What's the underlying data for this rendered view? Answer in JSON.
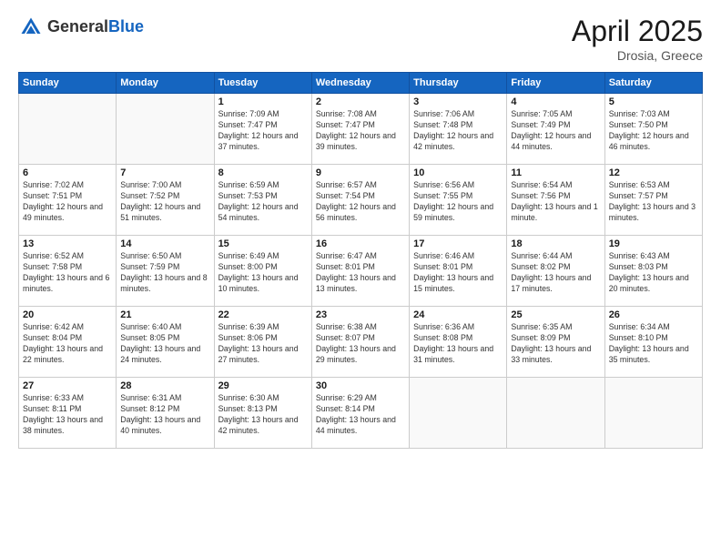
{
  "header": {
    "logo": {
      "general": "General",
      "blue": "Blue"
    },
    "title": "April 2025",
    "subtitle": "Drosia, Greece"
  },
  "weekdays": [
    "Sunday",
    "Monday",
    "Tuesday",
    "Wednesday",
    "Thursday",
    "Friday",
    "Saturday"
  ],
  "weeks": [
    [
      {
        "num": "",
        "info": ""
      },
      {
        "num": "",
        "info": ""
      },
      {
        "num": "1",
        "info": "Sunrise: 7:09 AM\nSunset: 7:47 PM\nDaylight: 12 hours and 37 minutes."
      },
      {
        "num": "2",
        "info": "Sunrise: 7:08 AM\nSunset: 7:47 PM\nDaylight: 12 hours and 39 minutes."
      },
      {
        "num": "3",
        "info": "Sunrise: 7:06 AM\nSunset: 7:48 PM\nDaylight: 12 hours and 42 minutes."
      },
      {
        "num": "4",
        "info": "Sunrise: 7:05 AM\nSunset: 7:49 PM\nDaylight: 12 hours and 44 minutes."
      },
      {
        "num": "5",
        "info": "Sunrise: 7:03 AM\nSunset: 7:50 PM\nDaylight: 12 hours and 46 minutes."
      }
    ],
    [
      {
        "num": "6",
        "info": "Sunrise: 7:02 AM\nSunset: 7:51 PM\nDaylight: 12 hours and 49 minutes."
      },
      {
        "num": "7",
        "info": "Sunrise: 7:00 AM\nSunset: 7:52 PM\nDaylight: 12 hours and 51 minutes."
      },
      {
        "num": "8",
        "info": "Sunrise: 6:59 AM\nSunset: 7:53 PM\nDaylight: 12 hours and 54 minutes."
      },
      {
        "num": "9",
        "info": "Sunrise: 6:57 AM\nSunset: 7:54 PM\nDaylight: 12 hours and 56 minutes."
      },
      {
        "num": "10",
        "info": "Sunrise: 6:56 AM\nSunset: 7:55 PM\nDaylight: 12 hours and 59 minutes."
      },
      {
        "num": "11",
        "info": "Sunrise: 6:54 AM\nSunset: 7:56 PM\nDaylight: 13 hours and 1 minute."
      },
      {
        "num": "12",
        "info": "Sunrise: 6:53 AM\nSunset: 7:57 PM\nDaylight: 13 hours and 3 minutes."
      }
    ],
    [
      {
        "num": "13",
        "info": "Sunrise: 6:52 AM\nSunset: 7:58 PM\nDaylight: 13 hours and 6 minutes."
      },
      {
        "num": "14",
        "info": "Sunrise: 6:50 AM\nSunset: 7:59 PM\nDaylight: 13 hours and 8 minutes."
      },
      {
        "num": "15",
        "info": "Sunrise: 6:49 AM\nSunset: 8:00 PM\nDaylight: 13 hours and 10 minutes."
      },
      {
        "num": "16",
        "info": "Sunrise: 6:47 AM\nSunset: 8:01 PM\nDaylight: 13 hours and 13 minutes."
      },
      {
        "num": "17",
        "info": "Sunrise: 6:46 AM\nSunset: 8:01 PM\nDaylight: 13 hours and 15 minutes."
      },
      {
        "num": "18",
        "info": "Sunrise: 6:44 AM\nSunset: 8:02 PM\nDaylight: 13 hours and 17 minutes."
      },
      {
        "num": "19",
        "info": "Sunrise: 6:43 AM\nSunset: 8:03 PM\nDaylight: 13 hours and 20 minutes."
      }
    ],
    [
      {
        "num": "20",
        "info": "Sunrise: 6:42 AM\nSunset: 8:04 PM\nDaylight: 13 hours and 22 minutes."
      },
      {
        "num": "21",
        "info": "Sunrise: 6:40 AM\nSunset: 8:05 PM\nDaylight: 13 hours and 24 minutes."
      },
      {
        "num": "22",
        "info": "Sunrise: 6:39 AM\nSunset: 8:06 PM\nDaylight: 13 hours and 27 minutes."
      },
      {
        "num": "23",
        "info": "Sunrise: 6:38 AM\nSunset: 8:07 PM\nDaylight: 13 hours and 29 minutes."
      },
      {
        "num": "24",
        "info": "Sunrise: 6:36 AM\nSunset: 8:08 PM\nDaylight: 13 hours and 31 minutes."
      },
      {
        "num": "25",
        "info": "Sunrise: 6:35 AM\nSunset: 8:09 PM\nDaylight: 13 hours and 33 minutes."
      },
      {
        "num": "26",
        "info": "Sunrise: 6:34 AM\nSunset: 8:10 PM\nDaylight: 13 hours and 35 minutes."
      }
    ],
    [
      {
        "num": "27",
        "info": "Sunrise: 6:33 AM\nSunset: 8:11 PM\nDaylight: 13 hours and 38 minutes."
      },
      {
        "num": "28",
        "info": "Sunrise: 6:31 AM\nSunset: 8:12 PM\nDaylight: 13 hours and 40 minutes."
      },
      {
        "num": "29",
        "info": "Sunrise: 6:30 AM\nSunset: 8:13 PM\nDaylight: 13 hours and 42 minutes."
      },
      {
        "num": "30",
        "info": "Sunrise: 6:29 AM\nSunset: 8:14 PM\nDaylight: 13 hours and 44 minutes."
      },
      {
        "num": "",
        "info": ""
      },
      {
        "num": "",
        "info": ""
      },
      {
        "num": "",
        "info": ""
      }
    ]
  ]
}
